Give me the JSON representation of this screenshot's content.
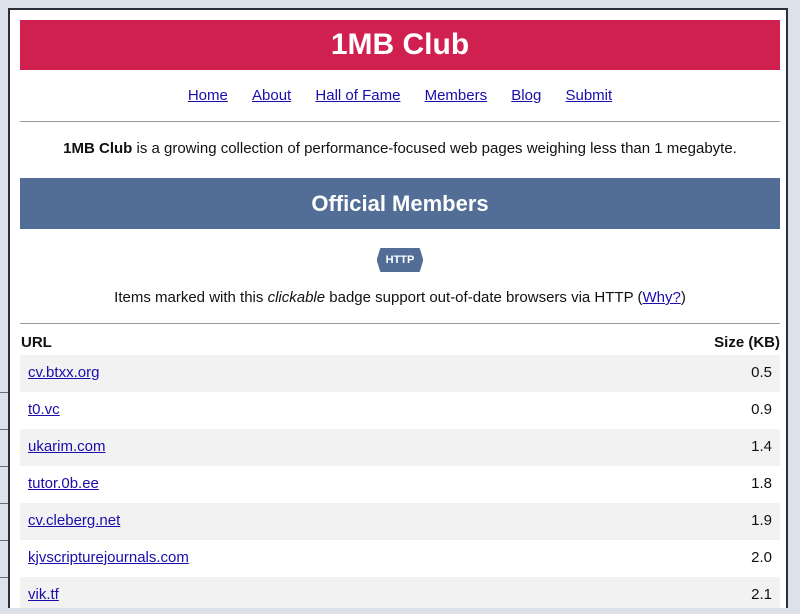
{
  "site": {
    "title": "1MB Club"
  },
  "nav": {
    "items": [
      {
        "label": "Home"
      },
      {
        "label": "About"
      },
      {
        "label": "Hall of Fame"
      },
      {
        "label": "Members"
      },
      {
        "label": "Blog"
      },
      {
        "label": "Submit"
      }
    ]
  },
  "intro": {
    "brand": "1MB Club",
    "text": " is a growing collection of performance-focused web pages weighing less than 1 megabyte."
  },
  "section": {
    "title": "Official Members"
  },
  "badge": {
    "label": "HTTP"
  },
  "note": {
    "before": "Items marked with this ",
    "emphasis": "clickable",
    "after": " badge support out-of-date browsers via HTTP (",
    "link": "Why?",
    "close": ")"
  },
  "table": {
    "headers": {
      "url": "URL",
      "size": "Size (KB)"
    },
    "rows": [
      {
        "url": "cv.btxx.org",
        "size": "0.5"
      },
      {
        "url": "t0.vc",
        "size": "0.9"
      },
      {
        "url": "ukarim.com",
        "size": "1.4"
      },
      {
        "url": "tutor.0b.ee",
        "size": "1.8"
      },
      {
        "url": "cv.cleberg.net",
        "size": "1.9"
      },
      {
        "url": "kjvscripturejournals.com",
        "size": "2.0"
      },
      {
        "url": "vik.tf",
        "size": "2.1"
      }
    ]
  },
  "colors": {
    "title_bar": "#d0204f",
    "section_bar": "#526d96",
    "link": "#1a0dab",
    "row_alt": "#f2f2f2"
  }
}
